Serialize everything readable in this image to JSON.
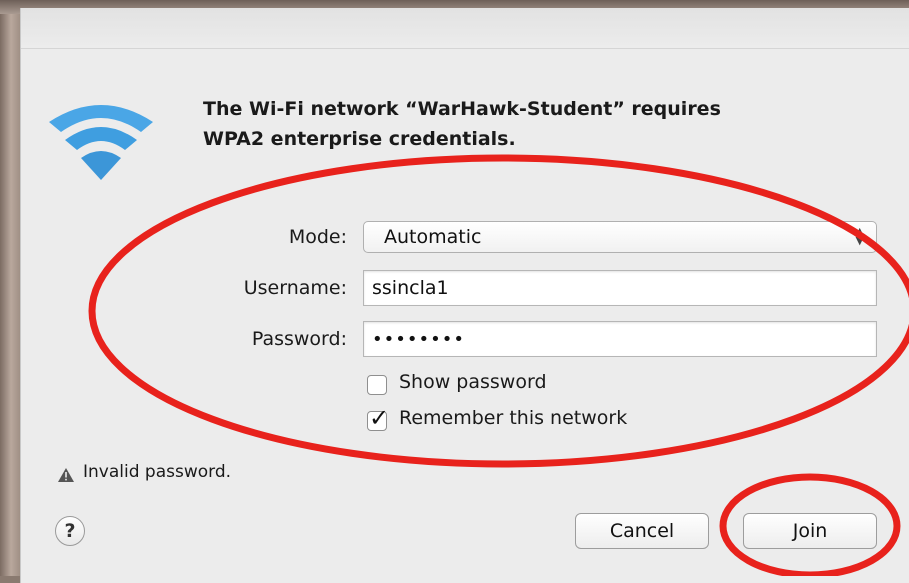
{
  "dialog": {
    "heading_line1": "The Wi-Fi network “WarHawk-Student” requires",
    "heading_line2": "WPA2 enterprise credentials."
  },
  "form": {
    "mode_label": "Mode:",
    "mode_value": "Automatic",
    "username_label": "Username:",
    "username_value": "ssincla1",
    "password_label": "Password:",
    "password_mask": "••••••••"
  },
  "options": {
    "show_password_label": "Show password",
    "show_password_checked": false,
    "remember_label": "Remember this network",
    "remember_checked": true
  },
  "status": {
    "warning_text": "Invalid password."
  },
  "buttons": {
    "help_label": "?",
    "cancel_label": "Cancel",
    "join_label": "Join"
  },
  "icons": {
    "wifi": "wifi-icon",
    "warning": "warning-triangle-icon",
    "help": "help-icon",
    "select_arrows": "chevron-updown-icon"
  },
  "colors": {
    "wifi_blue": "#3f9ee0",
    "annotation_red": "#e8221c"
  }
}
